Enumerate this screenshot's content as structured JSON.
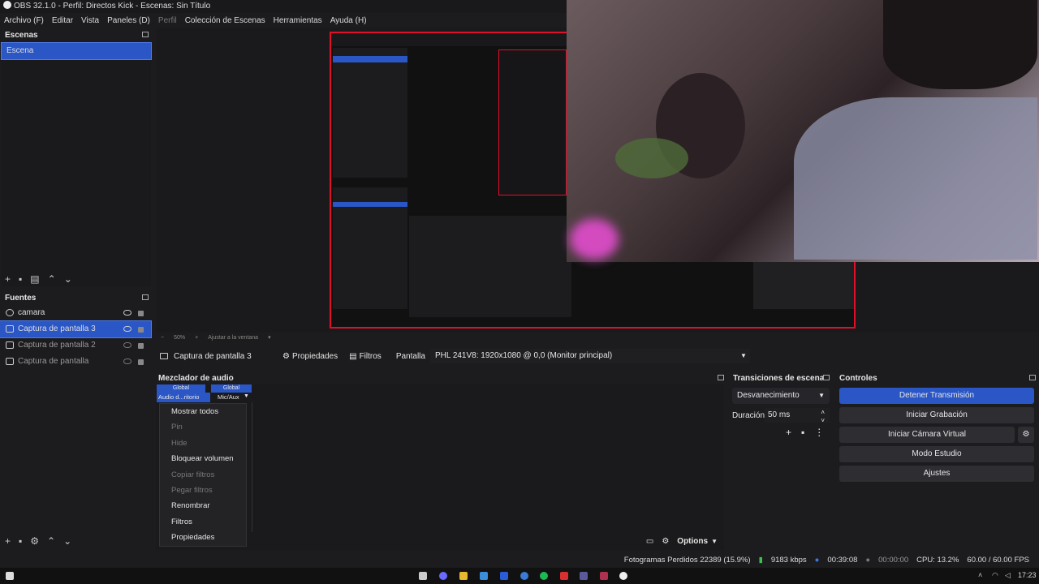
{
  "window": {
    "title": "OBS 32.1.0 - Perfil: Directos Kick - Escenas: Sin Título"
  },
  "menu": [
    "Archivo (F)",
    "Editar",
    "Vista",
    "Paneles (D)",
    "Perfil",
    "Colección de Escenas",
    "Herramientas",
    "Ayuda (H)"
  ],
  "scenes": {
    "title": "Escenas",
    "items": [
      {
        "label": "Escena"
      }
    ]
  },
  "sources": {
    "title": "Fuentes",
    "items": [
      {
        "label": "camara"
      },
      {
        "label": "Captura de pantalla 3"
      },
      {
        "label": "Captura de pantalla 2"
      },
      {
        "label": "Captura de pantalla"
      }
    ]
  },
  "preview_bar": {
    "zoom": "50%",
    "fit": "Ajustar a la ventana"
  },
  "context_bar": {
    "source": "Captura de pantalla 3",
    "properties": "Propiedades",
    "filters": "Filtros",
    "display_label": "Pantalla",
    "display_value": "PHL 241V8: 1920x1080 @ 0,0 (Monitor principal)"
  },
  "mixer": {
    "title": "Mezclador de audio",
    "col1_header": "Global",
    "col1_name": "Audio d...ritorio",
    "col2_header": "Global",
    "col2_name": "Mic/Aux",
    "options": "Options"
  },
  "context_menu": [
    {
      "label": "Mostrar todos",
      "disabled": false
    },
    {
      "label": "Pin",
      "disabled": true
    },
    {
      "label": "Hide",
      "disabled": true
    },
    {
      "label": "Bloquear volumen",
      "disabled": false
    },
    {
      "label": "Copiar filtros",
      "disabled": true
    },
    {
      "label": "Pegar filtros",
      "disabled": true
    },
    {
      "label": "Renombrar",
      "disabled": false
    },
    {
      "label": "Filtros",
      "disabled": false
    },
    {
      "label": "Propiedades",
      "disabled": false
    }
  ],
  "transitions": {
    "title": "Transiciones de escena",
    "selected": "Desvanecimiento",
    "duration_label": "Duración",
    "duration_value": "50 ms"
  },
  "controls": {
    "title": "Controles",
    "buttons": [
      "Detener Transmisión",
      "Iniciar Grabación",
      "Iniciar Cámara Virtual",
      "Modo Estudio",
      "Ajustes"
    ]
  },
  "status": {
    "dropped": "Fotogramas Perdidos 22389 (15.9%)",
    "bitrate": "9183 kbps",
    "stream_time": "00:39:08",
    "rec_time": "00:00:00",
    "cpu": "CPU: 13.2%",
    "fps": "60.00 / 60.00 FPS"
  },
  "taskbar": {
    "time": "17:23"
  },
  "colors": {
    "accent": "#2a56c6",
    "bg": "#1c1c1e",
    "recording_border": "#e0102a"
  }
}
